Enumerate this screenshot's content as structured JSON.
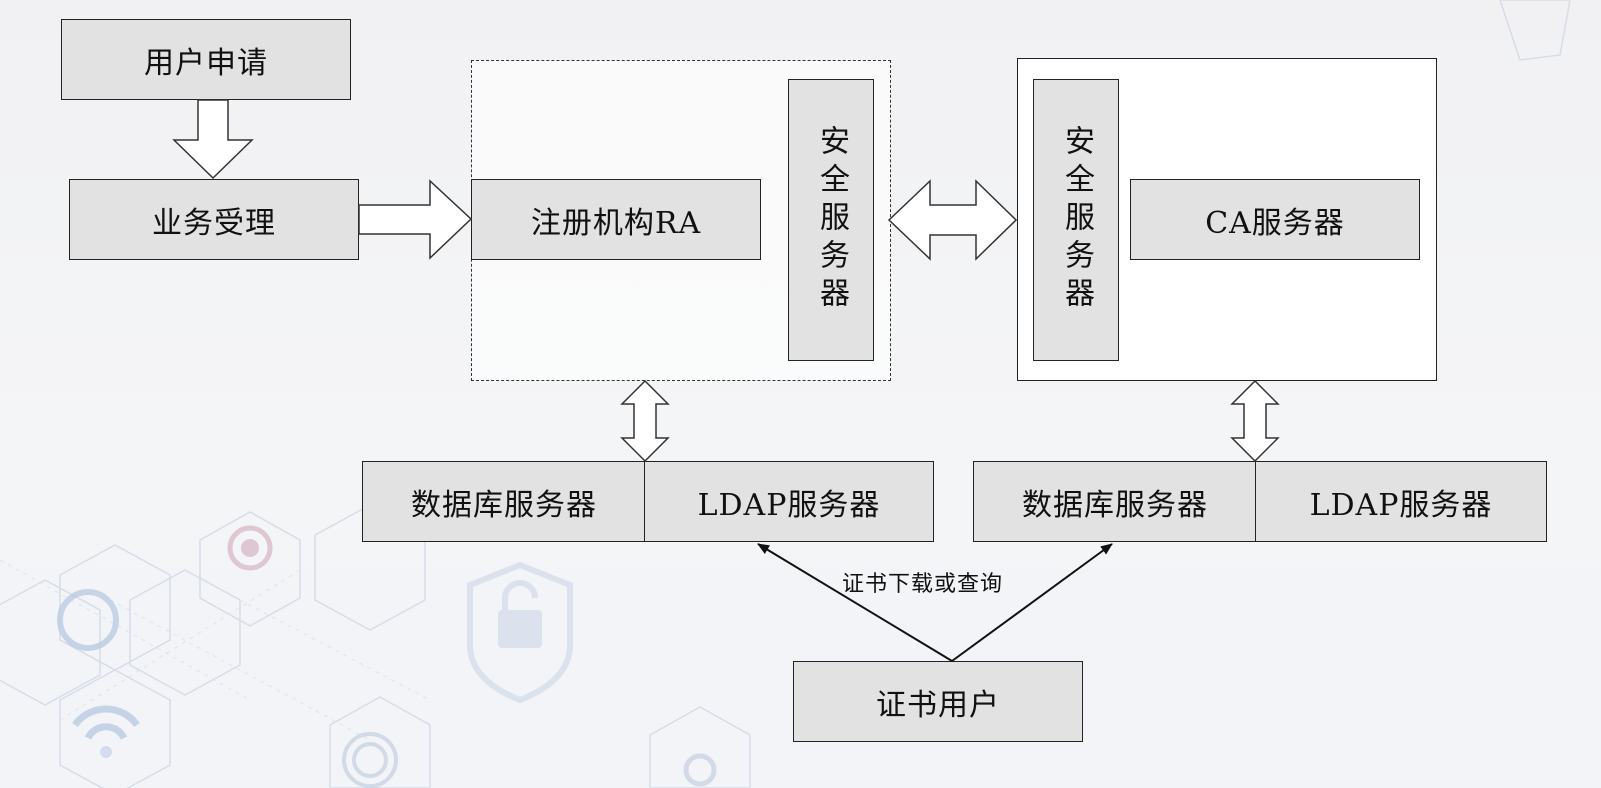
{
  "diagram": {
    "user_apply": "用户申请",
    "business_accept": "业务受理",
    "ra_name": "注册机构RA",
    "ra_security_server": "安全服务器",
    "ca_security_server": "安全服务器",
    "ca_server": "CA服务器",
    "ra_db_server": "数据库服务器",
    "ra_ldap_server": "LDAP服务器",
    "ca_db_server": "数据库服务器",
    "ca_ldap_server": "LDAP服务器",
    "download_query_label": "证书下载或查询",
    "cert_user": "证书用户"
  },
  "icons": [
    "hexagon-pattern",
    "refresh-icon",
    "touch-icon",
    "wifi-icon",
    "fingerprint-icon",
    "unlock-shield-icon",
    "location-icon"
  ]
}
